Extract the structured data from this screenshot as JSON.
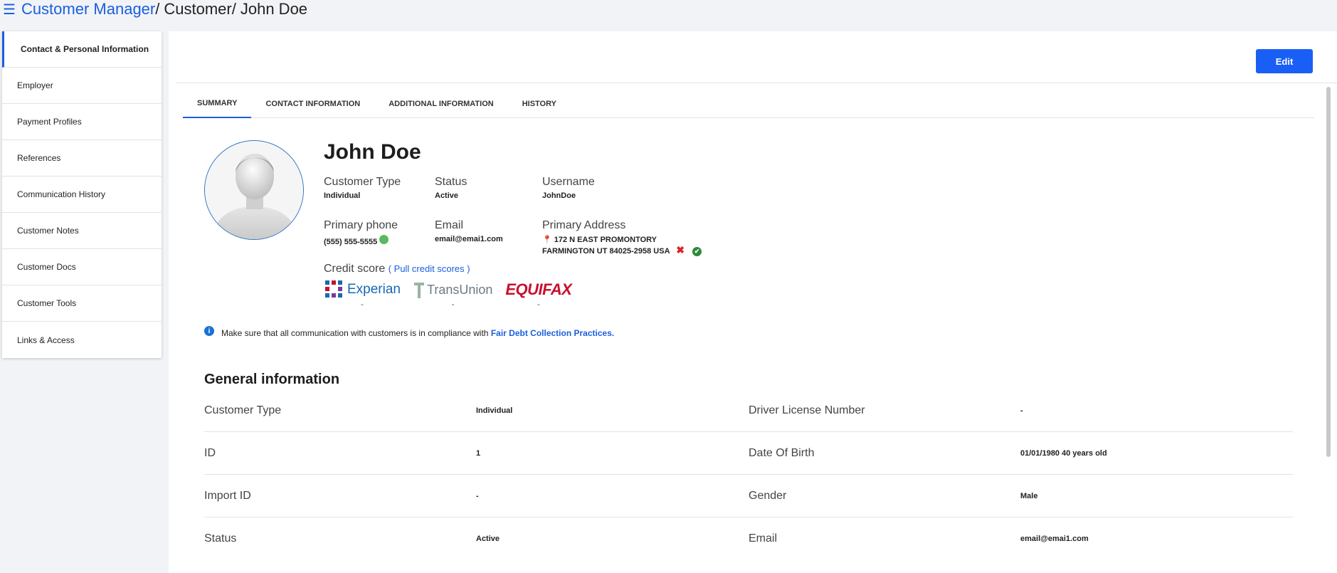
{
  "breadcrumb": {
    "root": "Customer Manager",
    "sep1": "/",
    "section": "Customer",
    "sep2": "/",
    "current": "John Doe"
  },
  "sidebar": {
    "items": [
      {
        "label": "Contact & Personal Information"
      },
      {
        "label": "Employer"
      },
      {
        "label": "Payment Profiles"
      },
      {
        "label": "References"
      },
      {
        "label": "Communication History"
      },
      {
        "label": "Customer Notes"
      },
      {
        "label": "Customer Docs"
      },
      {
        "label": "Customer Tools"
      },
      {
        "label": "Links & Access"
      }
    ]
  },
  "toolbar": {
    "edit_label": "Edit"
  },
  "tabs": [
    {
      "label": "SUMMARY"
    },
    {
      "label": "CONTACT INFORMATION"
    },
    {
      "label": "ADDITIONAL INFORMATION"
    },
    {
      "label": "HISTORY"
    }
  ],
  "profile": {
    "name": "John Doe",
    "customer_type_label": "Customer Type",
    "customer_type": "Individual",
    "status_label": "Status",
    "status": "Active",
    "username_label": "Username",
    "username": "JohnDoe",
    "phone_label": "Primary phone",
    "phone": "(555) 555-5555",
    "email_label": "Email",
    "email": "email@emai1.com",
    "address_label": "Primary Address",
    "address_line1": "172 N EAST PROMONTORY",
    "address_line2": "FARMINGTON UT 84025-2958 USA",
    "credit_label": "Credit score",
    "credit_link": "( Pull credit scores )",
    "bureaus": [
      {
        "name": "Experian",
        "score": "-"
      },
      {
        "name": "TransUnion",
        "score": "-"
      },
      {
        "name": "EQUIFAX",
        "score": "-"
      }
    ]
  },
  "notice": {
    "text": "Make sure that all communication with customers is in compliance with",
    "link": "Fair Debt Collection Practices."
  },
  "general": {
    "title": "General information",
    "rows": [
      {
        "l1": "Customer Type",
        "v1": "Individual",
        "l2": "Driver License Number",
        "v2": "-"
      },
      {
        "l1": "ID",
        "v1": "1",
        "l2": "Date Of Birth",
        "v2": "01/01/1980 40 years old"
      },
      {
        "l1": "Import ID",
        "v1": "-",
        "l2": "Gender",
        "v2": "Male"
      },
      {
        "l1": "Status",
        "v1": "Active",
        "l2": "Email",
        "v2": "email@emai1.com"
      }
    ]
  },
  "colors": {
    "accent": "#1a5fe0",
    "button": "#1a5ff5",
    "success": "#5cb85c",
    "error": "#e02020"
  }
}
